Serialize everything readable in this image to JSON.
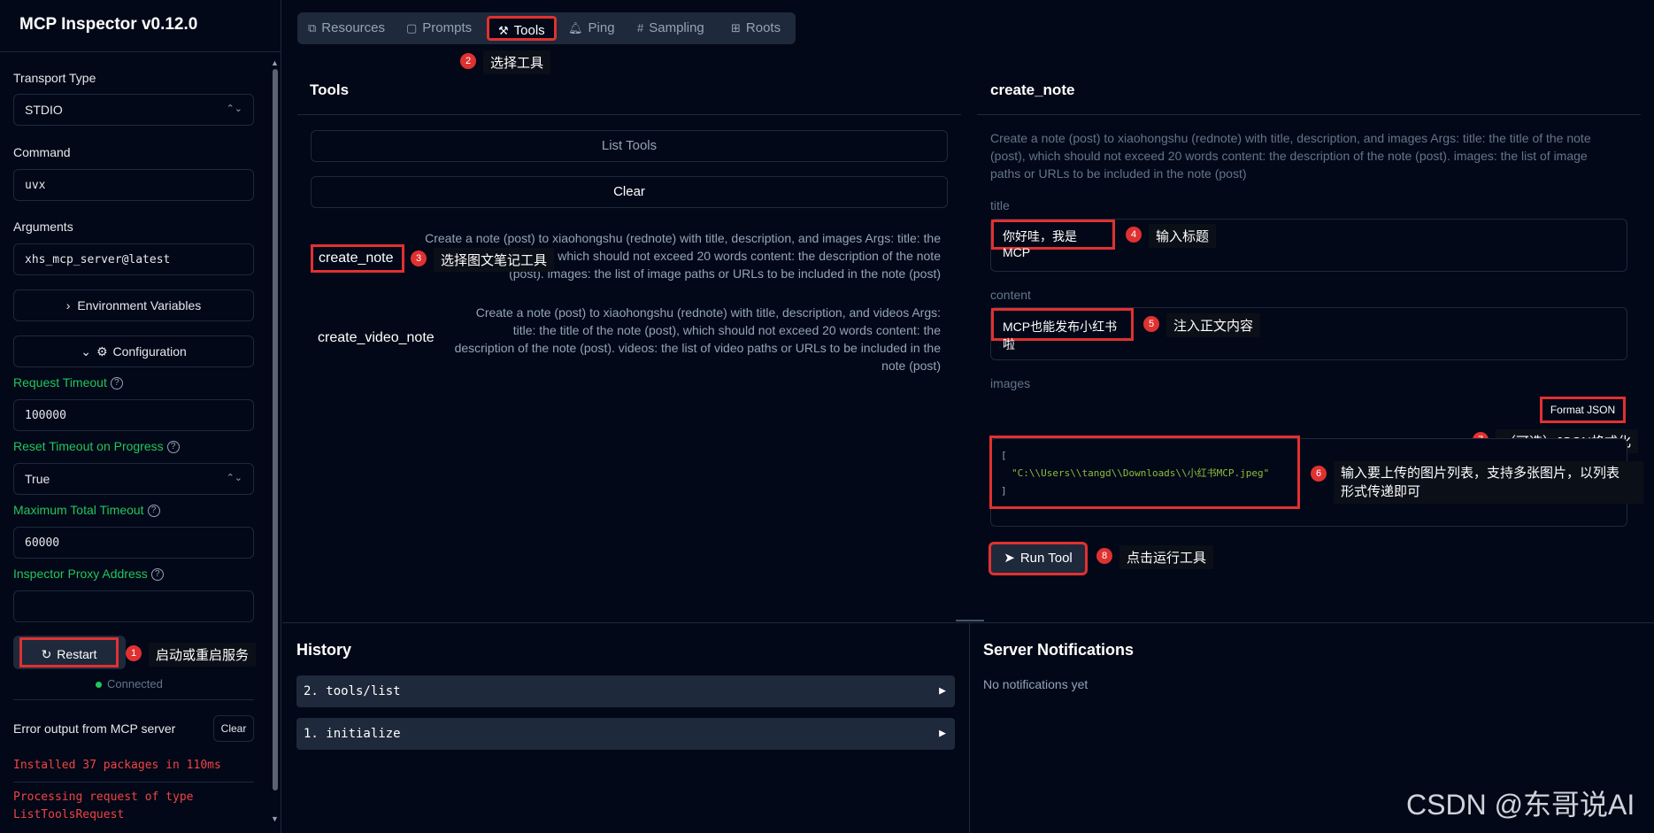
{
  "app": {
    "title": "MCP Inspector v0.12.0"
  },
  "sidebar": {
    "transport_label": "Transport Type",
    "transport_value": "STDIO",
    "command_label": "Command",
    "command_value": "uvx",
    "arguments_label": "Arguments",
    "arguments_value": "xhs_mcp_server@latest",
    "env_button": "Environment Variables",
    "config_button": "Configuration",
    "request_timeout_label": "Request Timeout",
    "request_timeout_value": "100000",
    "reset_timeout_label": "Reset Timeout on Progress",
    "reset_timeout_value": "True",
    "max_timeout_label": "Maximum Total Timeout",
    "max_timeout_value": "60000",
    "proxy_label": "Inspector Proxy Address",
    "proxy_value": "",
    "restart_button": "Restart",
    "status": "Connected",
    "error_header": "Error output from MCP server",
    "clear_button": "Clear",
    "errors": [
      "Installed 37 packages in 110ms",
      "Processing request of type",
      "ListToolsRequest"
    ]
  },
  "tabs": [
    "Resources",
    "Prompts",
    "Tools",
    "Ping",
    "Sampling",
    "Roots"
  ],
  "tools_panel": {
    "title": "Tools",
    "list_button": "List Tools",
    "clear_button": "Clear",
    "tools": [
      {
        "name": "create_note",
        "desc_lines": [
          "Create a note (post) to xiaohongshu (rednote) with title, description, and images Args: title: the",
          "title of the note (post), which should not exceed 20 words content: the description of the note",
          "(post). images: the list of image paths or URLs to be included in the note (post)"
        ]
      },
      {
        "name": "create_video_note",
        "desc_lines": [
          "Create a note (post) to xiaohongshu (rednote) with title, description, and videos Args:",
          "title: the title of the note (post), which should not exceed 20 words content: the",
          "description of the note (post). videos: the list of video paths or URLs to be included in the",
          "note (post)"
        ]
      }
    ]
  },
  "detail_panel": {
    "title": "create_note",
    "description": "Create a note (post) to xiaohongshu (rednote) with title, description, and images Args: title: the title of the note (post), which should not exceed 20 words content: the description of the note (post). images: the list of image paths or URLs to be included in the note (post)",
    "title_label": "title",
    "title_value": "你好哇，我是MCP",
    "content_label": "content",
    "content_value": "MCP也能发布小红书啦",
    "images_label": "images",
    "format_json_button": "Format JSON",
    "images_json_open": "[",
    "images_json_value": "\"C:\\\\Users\\\\tangd\\\\Downloads\\\\小红书MCP.jpeg\"",
    "images_json_close": "]",
    "run_button": "Run Tool"
  },
  "history": {
    "title": "History",
    "items": [
      "2. tools/list",
      "1. initialize"
    ]
  },
  "notifications": {
    "title": "Server Notifications",
    "empty": "No notifications yet"
  },
  "annotations": {
    "a1": {
      "num": "1",
      "text": "启动或重启服务"
    },
    "a2": {
      "num": "2",
      "text": "选择工具"
    },
    "a3": {
      "num": "3",
      "text": "选择图文笔记工具"
    },
    "a4": {
      "num": "4",
      "text": "输入标题"
    },
    "a5": {
      "num": "5",
      "text": "注入正文内容"
    },
    "a6": {
      "num": "6",
      "text_line1": "输入要上传的图片列表，支持多张图片，以列表",
      "text_line2": "形式传递即可"
    },
    "a7": {
      "num": "7",
      "text": "（可选）JSON格式化"
    },
    "a8": {
      "num": "8",
      "text": "点击运行工具"
    }
  },
  "watermark": "CSDN @东哥说AI",
  "colors": {
    "accent_green": "#22c55e",
    "annotation_red": "#e03131",
    "error_red": "#ef4444",
    "background": "#020817"
  }
}
